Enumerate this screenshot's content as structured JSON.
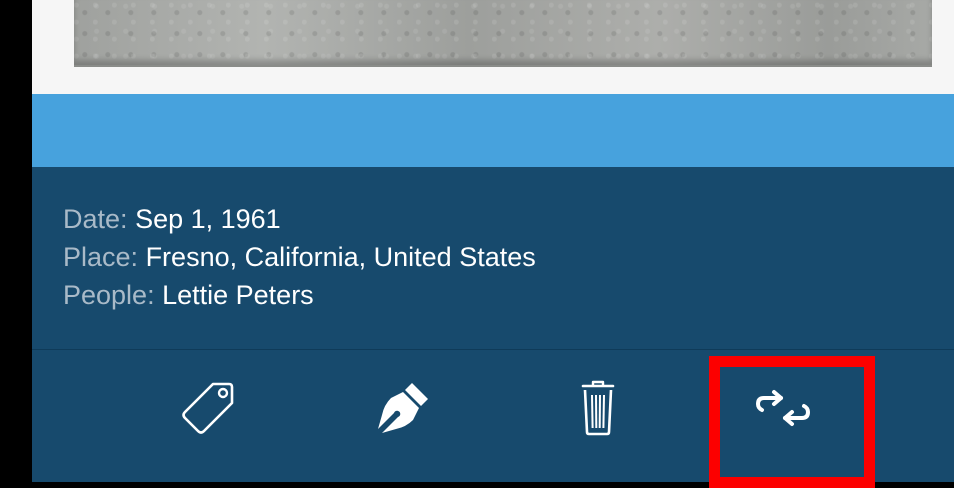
{
  "photo_metadata": {
    "date_label": "Date:",
    "date_value": "Sep 1, 1961",
    "place_label": "Place:",
    "place_value": "Fresno, California, United States",
    "people_label": "People:",
    "people_value": "Lettie Peters"
  },
  "toolbar": {
    "icons": [
      "tag-icon",
      "pen-icon",
      "trash-icon",
      "swap-icon"
    ]
  },
  "colors": {
    "background": "#000000",
    "photo_backdrop": "#f6f6f6",
    "accent_band": "#47a2dd",
    "panel": "#174a6d",
    "label_text": "#a9bac8",
    "value_text": "#ffffff",
    "highlight": "#fc0000"
  }
}
